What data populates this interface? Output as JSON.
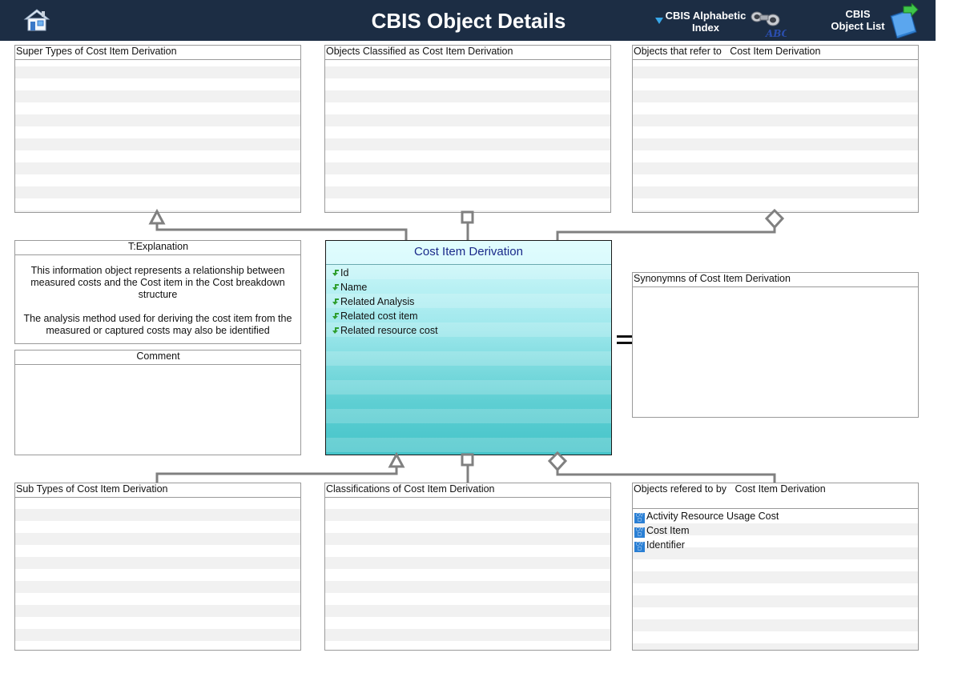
{
  "header": {
    "title": "CBIS Object Details",
    "alpha_index": {
      "line1": "CBIS Alphabetic",
      "line2": "Index"
    },
    "object_list": {
      "line1": "CBIS",
      "line2": "Object List"
    }
  },
  "panels": {
    "super_types": {
      "prefix": "Super Types of",
      "subject": "Cost Item Derivation"
    },
    "classified_as": {
      "prefix": "Objects Classified as",
      "subject": "Cost Item Derivation"
    },
    "refer_to": {
      "prefix": "Objects that refer to",
      "subject": "Cost Item Derivation"
    },
    "explanation": {
      "title": "T:Explanation",
      "para1": "This information object represents a relationship between measured costs and the Cost item in the Cost breakdown structure",
      "para2": "The analysis method used for deriving the cost item from the measured or captured costs may also be identified"
    },
    "comment": {
      "title": "Comment"
    },
    "synonyms": {
      "prefix": "Synonymns of",
      "subject": "Cost Item Derivation"
    },
    "sub_types": {
      "prefix": "Sub Types of",
      "subject": "Cost Item Derivation"
    },
    "classifications": {
      "prefix": "Classifications of",
      "subject": "Cost Item Derivation"
    },
    "refered_by": {
      "prefix": "Objects refered to by",
      "subject": "Cost Item Derivation",
      "items": [
        "Activity Resource Usage Cost",
        "Cost Item",
        "Identifier"
      ]
    }
  },
  "center": {
    "title": "Cost Item Derivation",
    "attributes": [
      "Id",
      "Name",
      "Related Analysis",
      "Related cost item",
      "Related resource cost"
    ]
  },
  "colors": {
    "header_bg": "#1c2d44",
    "center_gradient_top": "#d8fbfd",
    "center_gradient_bottom": "#45c4c9",
    "connector": "#808080",
    "attribute_arrow": "#2e9e2e",
    "object_icon": "#2a7fd4"
  },
  "icons": [
    "home-icon",
    "binoculars-abc-icon",
    "book-arrow-icon",
    "green-arrow-icon",
    "object-type-icon"
  ]
}
